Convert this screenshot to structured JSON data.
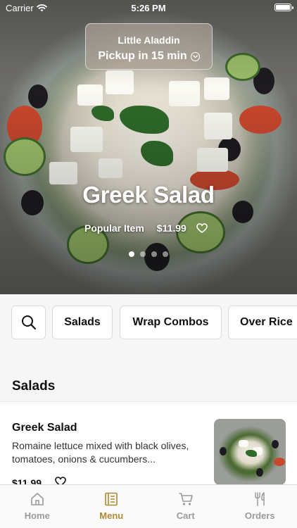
{
  "status_bar": {
    "carrier": "Carrier",
    "time": "5:26 PM"
  },
  "store": {
    "name": "Little Aladdin",
    "pickup": "Pickup in 15 min"
  },
  "hero": {
    "title": "Greek Salad",
    "tag": "Popular Item",
    "price": "$11.99",
    "slide_count": 4,
    "active_slide": 1
  },
  "categories": {
    "search_icon": "search-icon",
    "chips": [
      "Salads",
      "Wrap Combos",
      "Over Rice"
    ]
  },
  "section": {
    "title": "Salads"
  },
  "items": [
    {
      "name": "Greek Salad",
      "description": "Romaine lettuce mixed with black olives, tomatoes, onions & cucumbers...",
      "price": "$11.99"
    }
  ],
  "tabbar": {
    "tabs": [
      {
        "label": "Home",
        "icon": "home-icon"
      },
      {
        "label": "Menu",
        "icon": "menu-icon",
        "active": true
      },
      {
        "label": "Cart",
        "icon": "cart-icon"
      },
      {
        "label": "Orders",
        "icon": "fork-knife-icon"
      }
    ]
  },
  "colors": {
    "accent": "#b08930",
    "inactive_tab": "#9a9a9a"
  }
}
